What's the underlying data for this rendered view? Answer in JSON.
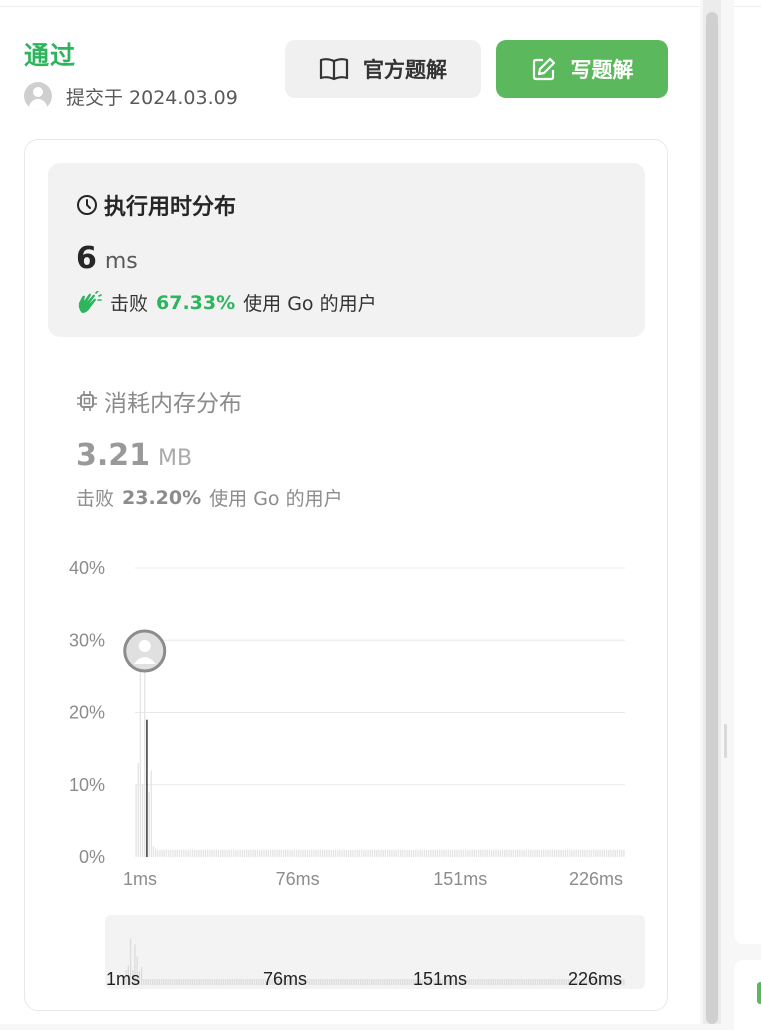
{
  "status": "通过",
  "submission": {
    "text": "提交于 2024.03.09"
  },
  "buttons": {
    "official_solution": "官方题解",
    "write_solution": "写题解"
  },
  "runtime": {
    "title": "执行用时分布",
    "value": "6",
    "unit": "ms",
    "beat_prefix": "击败",
    "beat_percent": "67.33%",
    "beat_suffix": "使用 Go 的用户"
  },
  "memory": {
    "title": "消耗内存分布",
    "value": "3.21",
    "unit": "MB",
    "beat_prefix": "击败",
    "beat_percent": "23.20%",
    "beat_suffix": "使用 Go 的用户"
  },
  "chart_data": {
    "type": "bar",
    "y_ticks": [
      "40%",
      "30%",
      "20%",
      "10%",
      "0%"
    ],
    "x_ticks": [
      "1ms",
      "76ms",
      "151ms",
      "226ms"
    ],
    "ylim": [
      0,
      40
    ],
    "xlim": [
      1,
      226
    ],
    "selected": {
      "x": 6,
      "y": 19
    },
    "series": [
      {
        "values": [
          {
            "x": 1,
            "y": 10
          },
          {
            "x": 2,
            "y": 13
          },
          {
            "x": 3,
            "y": 31
          },
          {
            "x": 4,
            "y": 10
          },
          {
            "x": 5,
            "y": 27
          },
          {
            "x": 6,
            "y": 19
          },
          {
            "x": 7,
            "y": 9
          },
          {
            "x": 8,
            "y": 12
          },
          {
            "x": 9,
            "y": 1.5
          },
          {
            "x": 10,
            "y": 1.2
          },
          {
            "x": 11,
            "y": 1
          }
        ]
      }
    ],
    "tail_value": 1,
    "colors": {
      "bar": "#e4e4e4",
      "selected": "#1a1a1a",
      "grid": "#e8e8e8",
      "accent": "#2db55d"
    }
  },
  "mini_chart": {
    "x_ticks": [
      "1ms",
      "76ms",
      "151ms",
      "226ms"
    ]
  }
}
